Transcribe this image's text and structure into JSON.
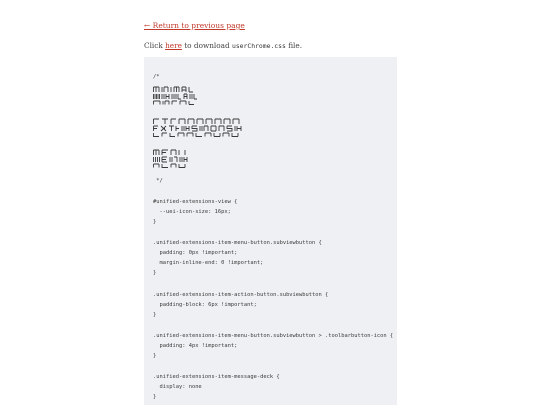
{
  "nav": {
    "back_link": "← Return to previous page"
  },
  "download": {
    "prefix": "Click",
    "link": "here",
    "middle": "to download",
    "filename": "userChrome.css",
    "suffix": "file."
  },
  "code": {
    "comment_open": "/*",
    "art_words": [
      "MINIMAL",
      "EXTENSIONS",
      "MENU"
    ],
    "comment_close": " */",
    "lines": [
      "#unified-extensions-view {",
      "  --uei-icon-size: 16px;",
      "}",
      ".unified-extensions-item-menu-button.subviewbutton {",
      "  padding: 0px !important;",
      "  margin-inline-end: 0 !important;",
      "}",
      ".unified-extensions-item-action-button.subviewbutton {",
      "  padding-block: 6px !important;",
      "}",
      ".unified-extensions-item-menu-button.subviewbutton > .toolbarbutton-icon {",
      "  padding: 4px !important;",
      "}",
      ".unified-extensions-item-message-deck {",
      "  display: none",
      "}"
    ]
  }
}
